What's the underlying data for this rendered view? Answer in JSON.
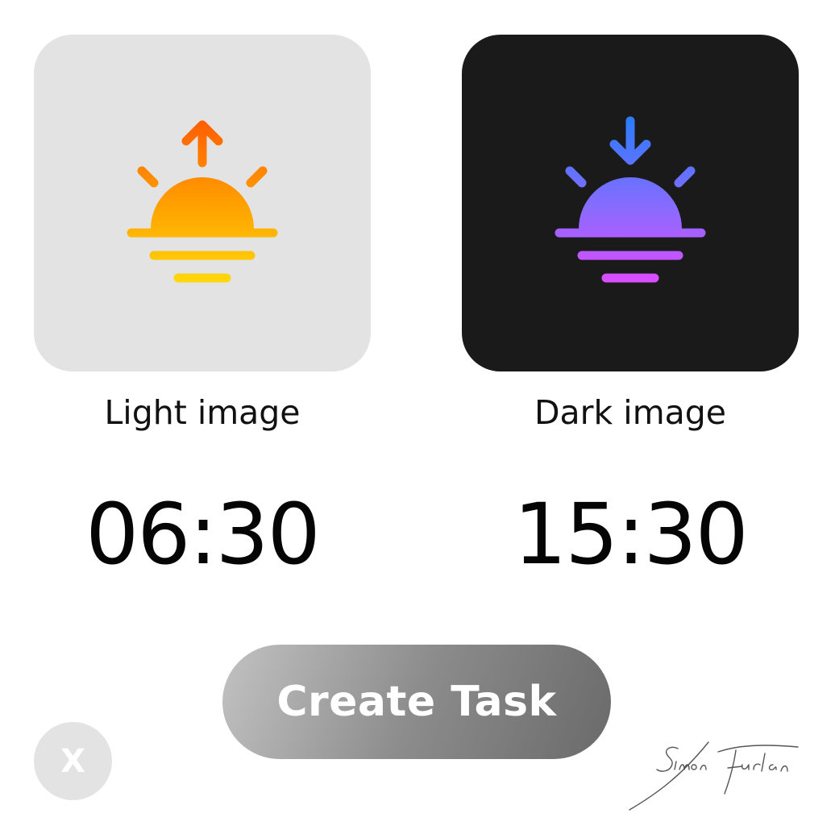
{
  "light": {
    "caption": "Light image",
    "time": "06:30",
    "icon": "sunrise-icon",
    "background": "#e3e3e3",
    "gradient": [
      "#ff6a00",
      "#ffd60a"
    ]
  },
  "dark": {
    "caption": "Dark image",
    "time": "15:30",
    "icon": "sunset-icon",
    "background": "#1a1a1a",
    "gradient": [
      "#2f7bff",
      "#d94dff"
    ]
  },
  "actions": {
    "create_label": "Create Task",
    "close_label": "X"
  },
  "signature": "Simon Furlan"
}
